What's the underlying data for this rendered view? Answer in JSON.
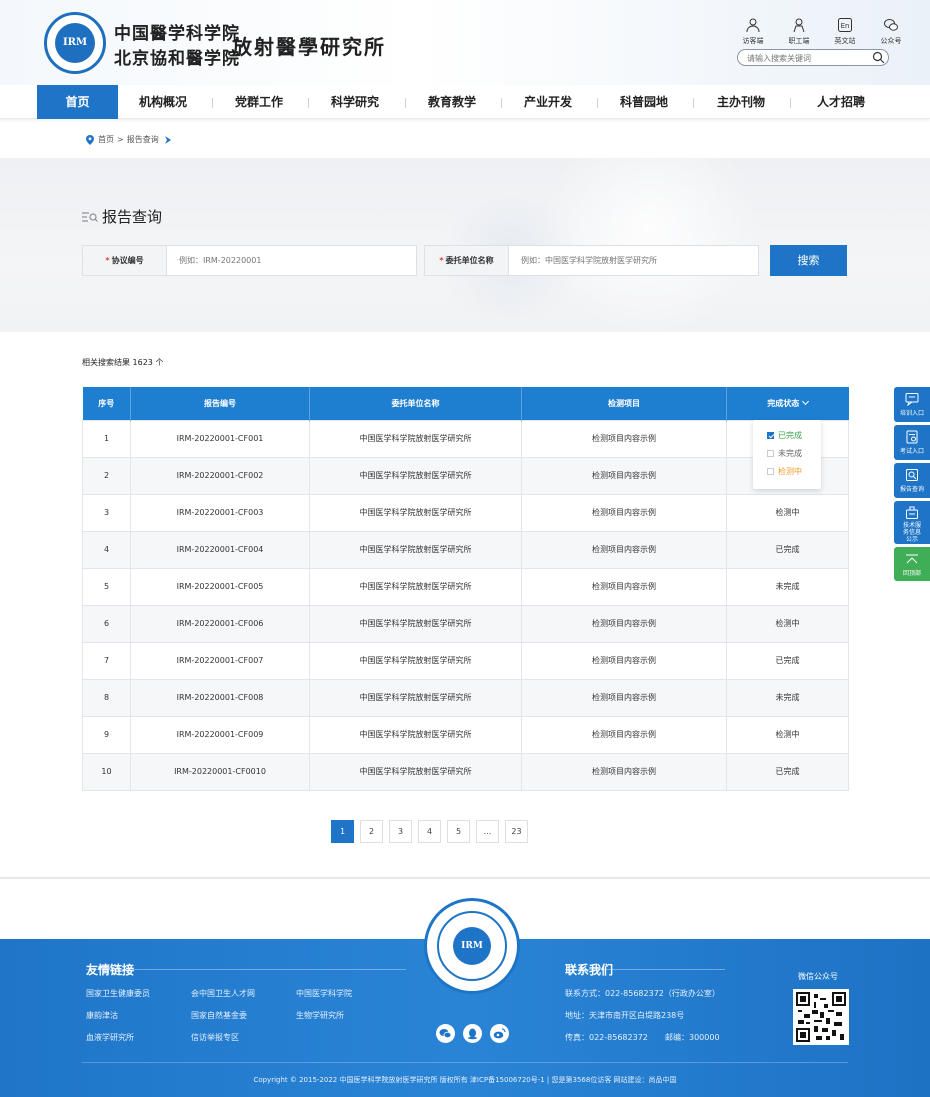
{
  "header": {
    "logo_line1": "中国醫学科学院",
    "logo_line2": "北京協和醫学院",
    "logo_dept": "放射醫學研究所",
    "logo_mark": "IRM",
    "top_links": [
      "访客端",
      "职工端",
      "英文站",
      "公众号"
    ],
    "search_placeholder": "请输入搜索关键词"
  },
  "nav": {
    "items": [
      "首页",
      "机构概况",
      "党群工作",
      "科学研究",
      "教育教学",
      "产业开发",
      "科普园地",
      "主办刊物",
      "人才招聘"
    ],
    "active_index": 0
  },
  "breadcrumb": {
    "home": "首页",
    "separator": ">",
    "current": "报告查询"
  },
  "query": {
    "title": "报告查询",
    "field1_label": "协议编号",
    "field1_placeholder": "例如：IRM-20220001",
    "field2_label": "委托单位名称",
    "field2_placeholder": "例如：中国医学科学院放射医学研究所",
    "required_mark": "*",
    "search_button": "搜索"
  },
  "results": {
    "count_text": "相关搜索结果 1623 个",
    "columns": [
      "序号",
      "报告编号",
      "委托单位名称",
      "检测项目",
      "完成状态"
    ],
    "rows": [
      {
        "no": "1",
        "code": "IRM-20220001-CF001",
        "org": "中国医学科学院放射医学研究所",
        "item": "检测项目内容示例",
        "status": "",
        "status_type": "done"
      },
      {
        "no": "2",
        "code": "IRM-20220001-CF002",
        "org": "中国医学科学院放射医学研究所",
        "item": "检测项目内容示例",
        "status": "",
        "status_type": "done"
      },
      {
        "no": "3",
        "code": "IRM-20220001-CF003",
        "org": "中国医学科学院放射医学研究所",
        "item": "检测项目内容示例",
        "status": "检测中",
        "status_type": "progress"
      },
      {
        "no": "4",
        "code": "IRM-20220001-CF004",
        "org": "中国医学科学院放射医学研究所",
        "item": "检测项目内容示例",
        "status": "已完成",
        "status_type": "done"
      },
      {
        "no": "5",
        "code": "IRM-20220001-CF005",
        "org": "中国医学科学院放射医学研究所",
        "item": "检测项目内容示例",
        "status": "未完成",
        "status_type": "pending"
      },
      {
        "no": "6",
        "code": "IRM-20220001-CF006",
        "org": "中国医学科学院放射医学研究所",
        "item": "检测项目内容示例",
        "status": "检测中",
        "status_type": "progress"
      },
      {
        "no": "7",
        "code": "IRM-20220001-CF007",
        "org": "中国医学科学院放射医学研究所",
        "item": "检测项目内容示例",
        "status": "已完成",
        "status_type": "done"
      },
      {
        "no": "8",
        "code": "IRM-20220001-CF008",
        "org": "中国医学科学院放射医学研究所",
        "item": "检测项目内容示例",
        "status": "未完成",
        "status_type": "pending"
      },
      {
        "no": "9",
        "code": "IRM-20220001-CF009",
        "org": "中国医学科学院放射医学研究所",
        "item": "检测项目内容示例",
        "status": "检测中",
        "status_type": "progress"
      },
      {
        "no": "10",
        "code": "IRM-20220001-CF0010",
        "org": "中国医学科学院放射医学研究所",
        "item": "检测项目内容示例",
        "status": "已完成",
        "status_type": "done"
      }
    ],
    "status_filter": {
      "options": [
        {
          "label": "已完成",
          "checked": true,
          "color": "#3aa24a"
        },
        {
          "label": "未完成",
          "checked": false,
          "color": "#666666"
        },
        {
          "label": "检测中",
          "checked": false,
          "color": "#f09a2a"
        }
      ]
    }
  },
  "pagination": {
    "prev": "‹",
    "pages": [
      "1",
      "2",
      "3",
      "4",
      "5",
      "...",
      "23"
    ],
    "active_page": "1",
    "next": "›"
  },
  "side_float": [
    {
      "label": "培训入口",
      "icon": "chat-icon"
    },
    {
      "label": "考试入口",
      "icon": "exam-icon"
    },
    {
      "label": "报告查询",
      "icon": "report-search-icon"
    },
    {
      "label": "技术服务信息公示",
      "icon": "notice-icon"
    },
    {
      "label": "回顶部",
      "icon": "back-top-icon"
    }
  ],
  "footer": {
    "links_title": "友情链接",
    "links": [
      "国家卫生健康委员",
      "会中国卫生人才网",
      "中国医学科学院",
      "康韵津沽",
      "国家自然基金委",
      "生物学研究所",
      "血液学研究所",
      "信访举报专区"
    ],
    "contact_title": "联系我们",
    "contact_phone": "联系方式：022-85682372（行政办公室）",
    "contact_address": "地址：天津市南开区白堤路238号",
    "contact_fax": "传真：022-85682372",
    "contact_zip": "邮编：300000",
    "wechat_title": "微信公众号",
    "copyright": "Copyright © 2015-2022 中国医学科学院放射医学研究所 版权所有   津ICP备15006720号-1  |  您是第3568位访客   网站建设：尚品中国"
  },
  "colors": {
    "primary": "#1e74c6",
    "table_header": "#1e7ed0",
    "done": "#3aa24a",
    "progress": "#f09a2a",
    "pending": "#666666",
    "side_green": "#3fae56"
  }
}
